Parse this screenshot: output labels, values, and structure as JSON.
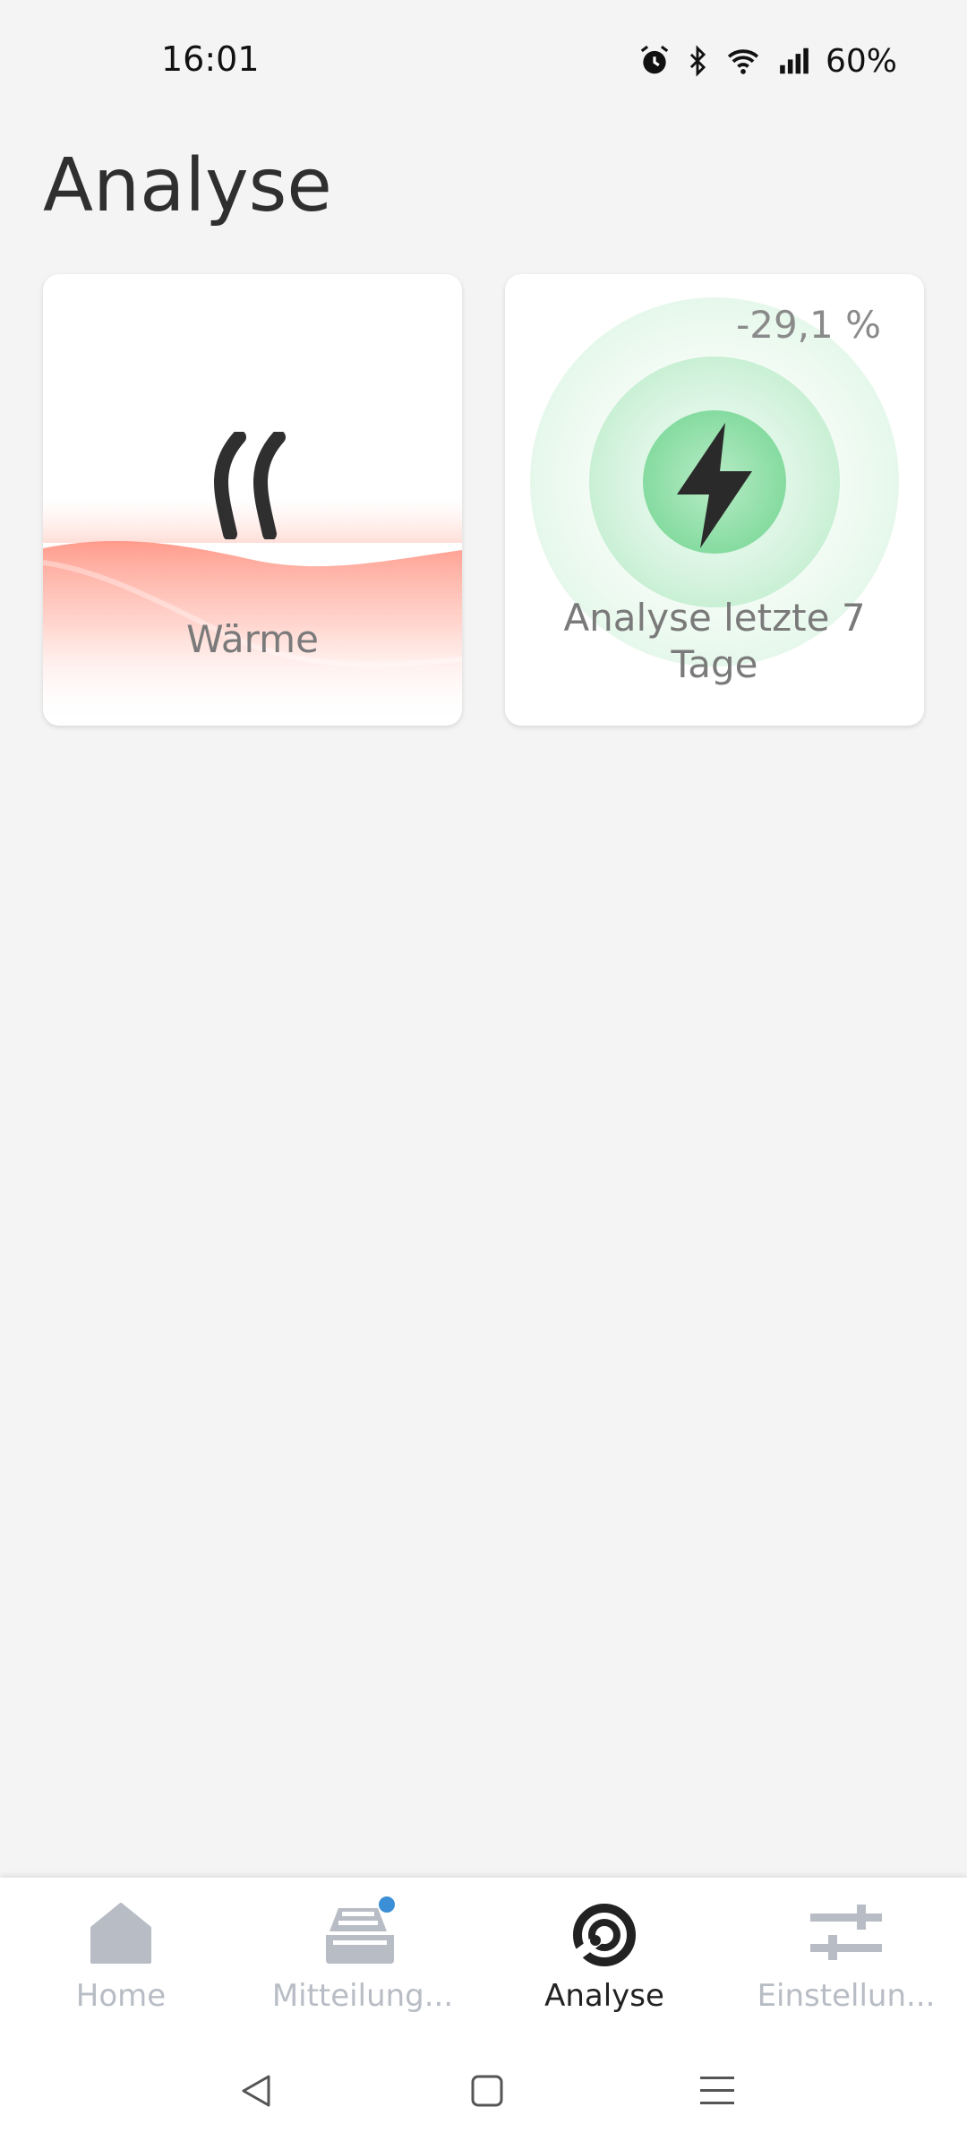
{
  "status": {
    "time": "16:01",
    "battery": "60%"
  },
  "page": {
    "title": "Analyse"
  },
  "cards": {
    "heat": {
      "label": "Wärme",
      "icon": "heat-waves-icon"
    },
    "power": {
      "percent": "-29,1 %",
      "label_line1": "Analyse letzte 7",
      "label_line2": "Tage",
      "icon": "lightning-bolt-icon"
    }
  },
  "nav": {
    "items": [
      {
        "label": "Home",
        "icon": "home-icon"
      },
      {
        "label": "Mitteilung...",
        "icon": "inbox-icon"
      },
      {
        "label": "Analyse",
        "icon": "analysis-icon"
      },
      {
        "label": "Einstellun...",
        "icon": "sliders-icon"
      }
    ]
  },
  "colors": {
    "heat_accent": "#ff8a78",
    "power_accent": "#7fdc9b",
    "notification_dot": "#3b8fd6"
  }
}
